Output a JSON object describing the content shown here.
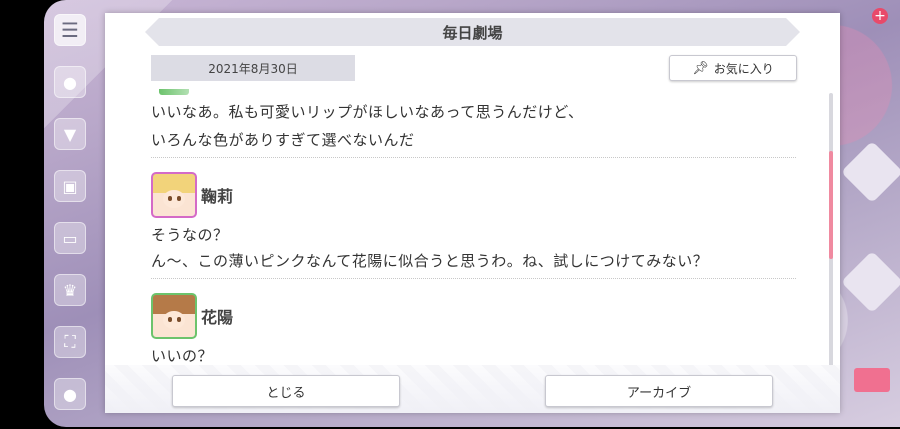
{
  "dialog": {
    "title": "毎日劇場",
    "date": "2021年8月30日",
    "favorite_label": "お気に入り"
  },
  "entries": [
    {
      "lines": [
        "いいなあ。私も可愛いリップがほしいなあって思うんだけど、",
        "いろんな色がありすぎて選べないんだ"
      ]
    },
    {
      "speaker": "鞠莉",
      "lines": [
        "そうなの？",
        "ん〜、この薄いピンクなんて花陽に似合うと思うわ。ね、試しにつけてみない？"
      ]
    },
    {
      "speaker": "花陽",
      "lines": [
        "いいの？"
      ]
    }
  ],
  "footer": {
    "close_label": "とじる",
    "archive_label": "アーカイブ"
  },
  "colors": {
    "accent": "#f08aa0",
    "title_bg": "#e3e3ea"
  },
  "icons": {
    "favorite": "pin-icon",
    "menu": "hamburger-icon"
  }
}
